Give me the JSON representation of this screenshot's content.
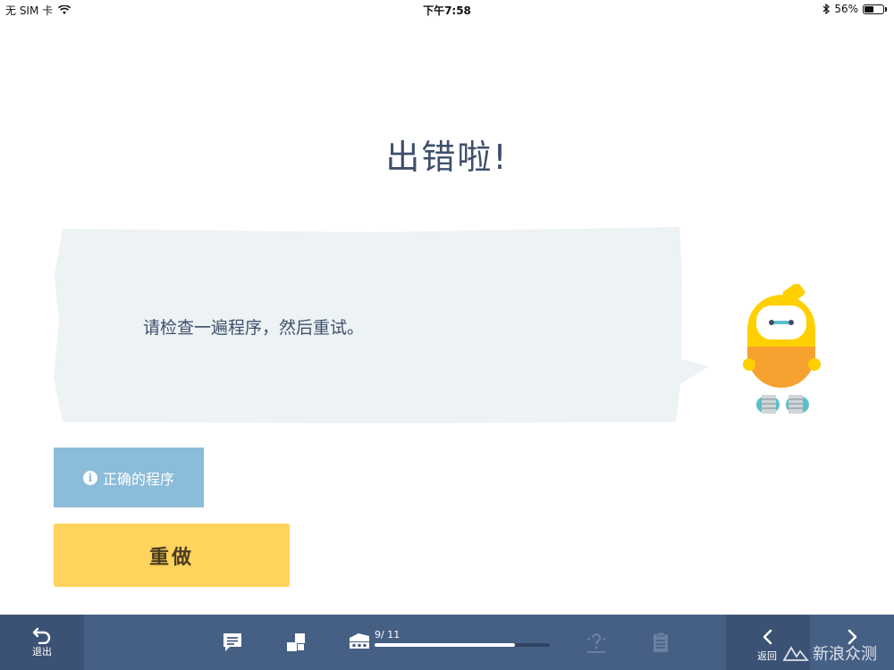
{
  "status_bar": {
    "carrier": "无 SIM 卡",
    "time": "下午7:58",
    "battery": "56%",
    "battery_level": 0.56
  },
  "dialog": {
    "title": "出错啦!",
    "message": "请检查一遍程序，然后重试。"
  },
  "buttons": {
    "hint_label": "正确的程序",
    "redo_label": "重做"
  },
  "bottom_bar": {
    "exit_label": "退出",
    "progress_text": "9/ 11",
    "progress_value": 0.8,
    "back_label": "返回",
    "icons": [
      "chat-icon",
      "blocks-icon",
      "robot-progress-icon",
      "hint-icon",
      "clipboard-icon"
    ]
  },
  "watermark": "新浪众测",
  "colors": {
    "title": "#3d4f6b",
    "bubble": "#edf2f5",
    "hint_button": "#8bbcd9",
    "redo_button": "#ffd35c",
    "bottom_bar": "#465f84",
    "robot_yellow": "#ffd000",
    "robot_orange": "#f7a130"
  }
}
